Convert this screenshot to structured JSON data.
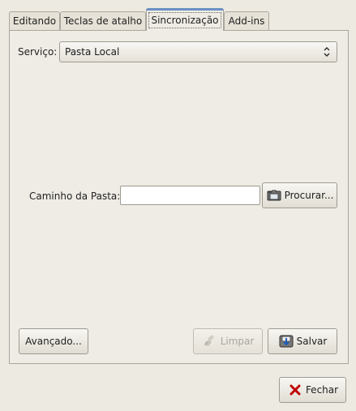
{
  "tabs": [
    {
      "label": "Editando"
    },
    {
      "label": "Teclas de atalho"
    },
    {
      "label": "Sincronização",
      "active": true
    },
    {
      "label": "Add-ins"
    }
  ],
  "service": {
    "label": "Serviço:",
    "value": "Pasta Local",
    "icon": "combo-arrows-icon"
  },
  "path": {
    "label": "Caminho da Pasta:",
    "value": "",
    "browse_label": "Procurar...",
    "browse_icon": "folder-icon"
  },
  "actions": {
    "advanced_label": "Avançado...",
    "clear_label": "Limpar",
    "clear_icon": "broom-icon",
    "save_label": "Salvar",
    "save_icon": "save-icon"
  },
  "footer": {
    "close_label": "Fechar",
    "close_icon": "close-icon"
  },
  "colors": {
    "background": "#edeae2",
    "active_tab_accent": "#6b8fc3",
    "close_x": "#c00000"
  }
}
